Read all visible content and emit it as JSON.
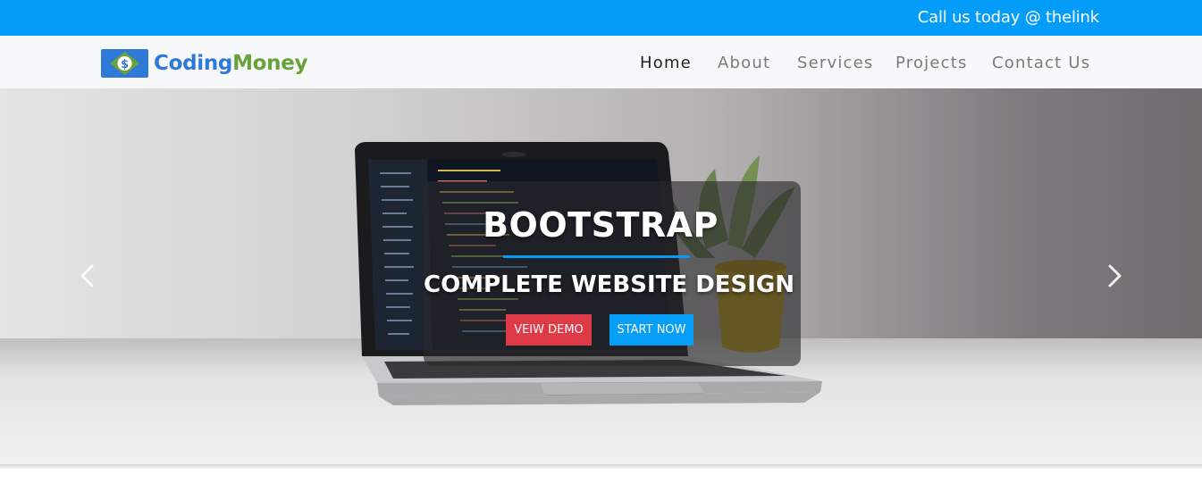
{
  "topbar": {
    "text": "Call us today @ thelink",
    "background": "#039cf8"
  },
  "brand": {
    "name_part1": "Coding",
    "name_part2": "Money",
    "icon": "dollar-logo-icon",
    "color1": "#2f7ad6",
    "color2": "#69a23a"
  },
  "nav": {
    "items": [
      {
        "label": "Home",
        "active": true
      },
      {
        "label": "About",
        "active": false
      },
      {
        "label": "Services",
        "active": false
      },
      {
        "label": "Projects",
        "active": false
      },
      {
        "label": "Contact Us",
        "active": false
      }
    ]
  },
  "hero": {
    "title": "BOOTSTRAP",
    "subtitle": "COMPLETE WEBSITE DESIGN",
    "demo_button": "VEIW DEMO",
    "start_button": "START NOW",
    "prev_icon": "chevron-left-icon",
    "next_icon": "chevron-right-icon",
    "accent": "#039cf8",
    "demo_color": "#dd3a45"
  }
}
